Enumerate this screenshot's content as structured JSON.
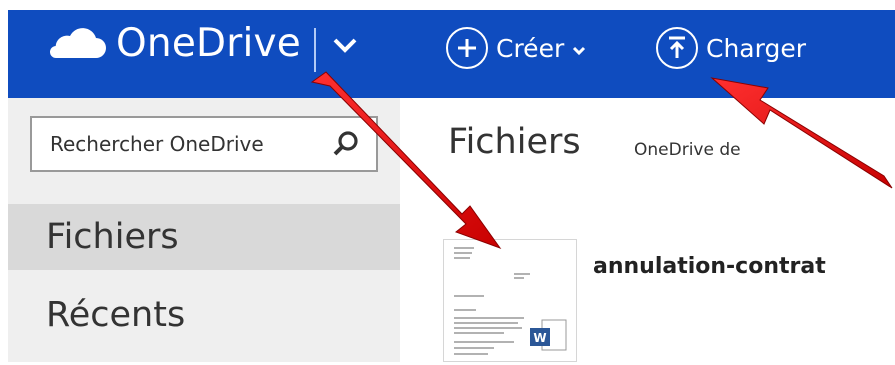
{
  "header": {
    "logo_text": "OneDrive",
    "create_label": "Créer",
    "upload_label": "Charger",
    "background_color": "#0f4cbf",
    "icons": [
      "cloud-icon",
      "chevron-down-icon",
      "plus-circle-icon",
      "upload-icon"
    ]
  },
  "search": {
    "placeholder": "Rechercher OneDrive",
    "icon": "search-icon"
  },
  "sidebar": {
    "items": [
      {
        "label": "Fichiers",
        "active": true
      },
      {
        "label": "Récents",
        "active": false
      }
    ]
  },
  "main": {
    "title": "Fichiers",
    "subtitle": "OneDrive de",
    "files": [
      {
        "name": "annulation-contrat",
        "type": "Word document"
      }
    ]
  },
  "annotations": {
    "arrow_color": "#e00000"
  }
}
